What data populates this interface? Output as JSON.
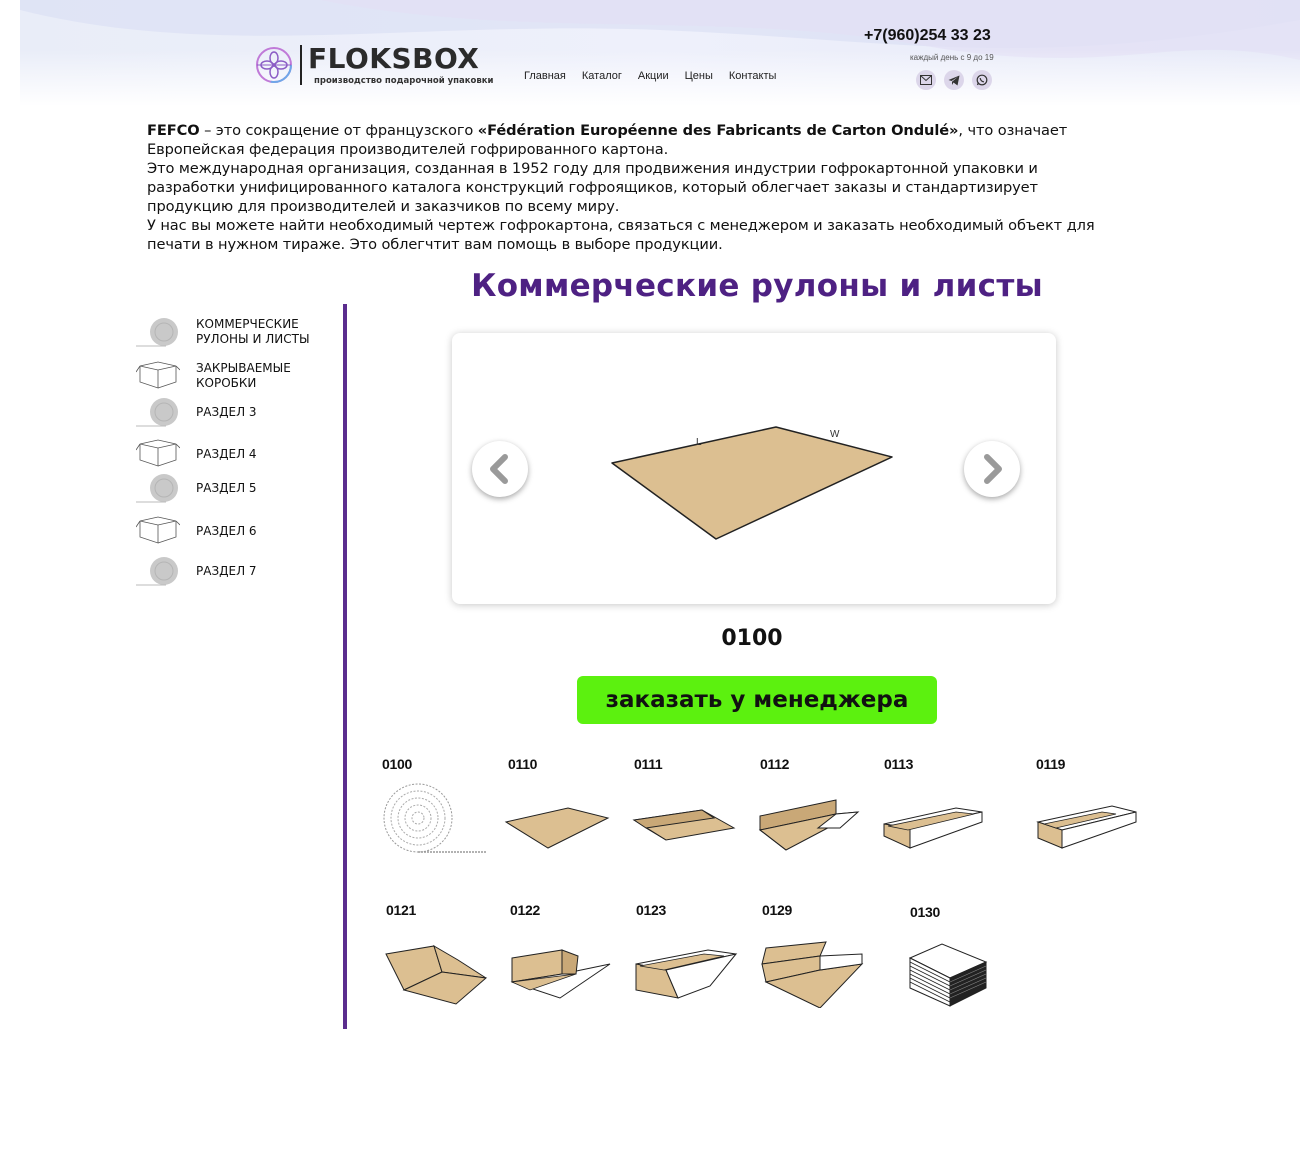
{
  "header": {
    "brand": "FLOKSBOX",
    "tagline": "производство подарочной упаковки",
    "nav": [
      "Главная",
      "Каталог",
      "Акции",
      "Цены",
      "Контакты"
    ],
    "phone": "+7(960)254 33 23",
    "hours": "каждый день с 9 до 19",
    "contact_icons": [
      "mail-icon",
      "telegram-icon",
      "whatsapp-icon"
    ]
  },
  "intro": {
    "p1_lead": "FEFCO",
    "p1_mid": " – это сокращение от французского ",
    "p1_bold": "«Fédération Européenne des Fabricants de Carton Ondulé»",
    "p1_tail": ", что означает Европейская федерация производителей гофрированного картона.",
    "p2": "Это международная организация, созданная в 1952 году для продвижения индустрии гофрокартонной упаковки и разработки унифицированного каталога конструкций гофроящиков, который облегчает заказы и стандартизирует продукцию для производителей и заказчиков по всему миру.",
    "p3": "У нас вы можете найти необходимый чертеж гофрокартона, связаться с менеджером и заказать необходимый объект для печати в нужном тираже. Это облегчтит вам помощь в выборе продукции."
  },
  "section_title": "Коммерческие рулоны и листы",
  "sidebar": [
    {
      "label": "КОММЕРЧЕСКИЕ РУЛОНЫ И ЛИСТЫ",
      "icon": "roll-icon"
    },
    {
      "label": "ЗАКРЫВАЕМЫЕ КОРОБКИ",
      "icon": "box-icon"
    },
    {
      "label": "РАЗДЕЛ 3",
      "icon": "roll-icon"
    },
    {
      "label": "РАЗДЕЛ 4",
      "icon": "box-icon"
    },
    {
      "label": "РАЗДЕЛ 5",
      "icon": "roll-icon"
    },
    {
      "label": "РАЗДЕЛ 6",
      "icon": "box-icon"
    },
    {
      "label": "РАЗДЕЛ 7",
      "icon": "roll-icon"
    }
  ],
  "slider": {
    "code": "0100",
    "label_l": "L",
    "label_w": "W"
  },
  "order_button": "заказать у менеджера",
  "grid": [
    {
      "code": "0100",
      "shape": "roll"
    },
    {
      "code": "0110",
      "shape": "sheet"
    },
    {
      "code": "0111",
      "shape": "fold1"
    },
    {
      "code": "0112",
      "shape": "fold2"
    },
    {
      "code": "0113",
      "shape": "tray"
    },
    {
      "code": "0119",
      "shape": "tray2"
    },
    {
      "code": "0121",
      "shape": "fold3"
    },
    {
      "code": "0122",
      "shape": "fold4"
    },
    {
      "code": "0123",
      "shape": "tray"
    },
    {
      "code": "0129",
      "shape": "tray3"
    },
    {
      "code": "0130",
      "shape": "stack"
    }
  ],
  "colors": {
    "accent_purple": "#4e2183",
    "divider": "#5b2d8e",
    "order_button": "#5cf10f",
    "cardboard": "#dcbf91"
  }
}
